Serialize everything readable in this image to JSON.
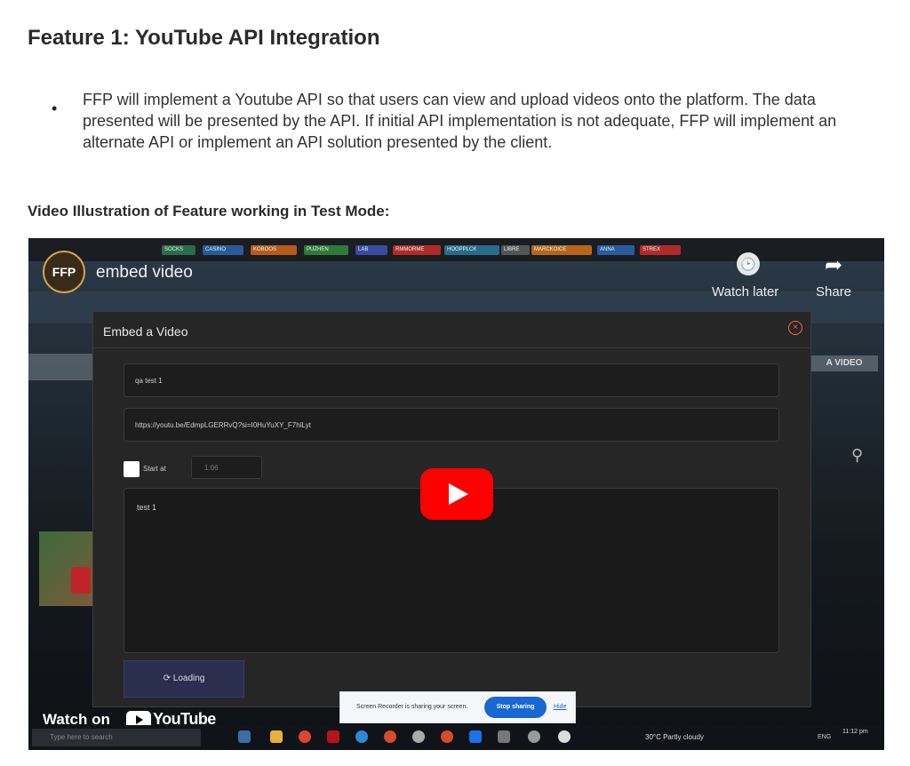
{
  "document": {
    "heading": "Feature 1: YouTube API Integration",
    "bullet_glyph": "•",
    "paragraph": "FFP will implement a Youtube API so that users can view and upload videos onto the platform. The data presented will be presented by the API. If initial API implementation is not adequate, FFP will implement an alternate API or implement an API solution presented by the client.",
    "subheading": "Video Illustration of Feature working in Test Mode:"
  },
  "video": {
    "channel_logo_text": "FFP",
    "title": "embed video",
    "watch_later_label": "Watch later",
    "share_label": "Share",
    "watch_on_label": "Watch on",
    "youtube_wordmark": "YouTube",
    "bg_right_button": "A VIDEO",
    "icons": [
      "clock-icon",
      "share-arrow-icon",
      "play-icon",
      "youtube-logo-icon",
      "close-circle-icon",
      "spinner-icon",
      "search-icon"
    ],
    "play_color": "#ff0000"
  },
  "browser_tabs": [
    "SOCKS",
    "CASINO",
    "KOBOOS",
    "PUZHEN",
    "LAB",
    "RMMORME",
    "HOOPPLCK",
    "LIBRE",
    "MARCKOICE",
    "ANNA",
    "STREX"
  ],
  "modal": {
    "title": "Embed a Video",
    "field_title_value": "qa test 1",
    "field_url_value": "https://youtu.be/EdmpLGERRvQ?si=I0HuYuXY_F7hlLyt",
    "start_at_label": "Start at",
    "start_at_value": "1:06",
    "description_value": "test 1",
    "loading_label": "Loading"
  },
  "screen_share": {
    "message": "Screen Recorder is sharing your screen.",
    "stop_button": "Stop sharing",
    "hide_link": "Hide"
  },
  "taskbar": {
    "search_placeholder": "Type here to search",
    "weather": "30°C Partly cloudy",
    "language": "ENG",
    "time": "11:12 pm"
  }
}
